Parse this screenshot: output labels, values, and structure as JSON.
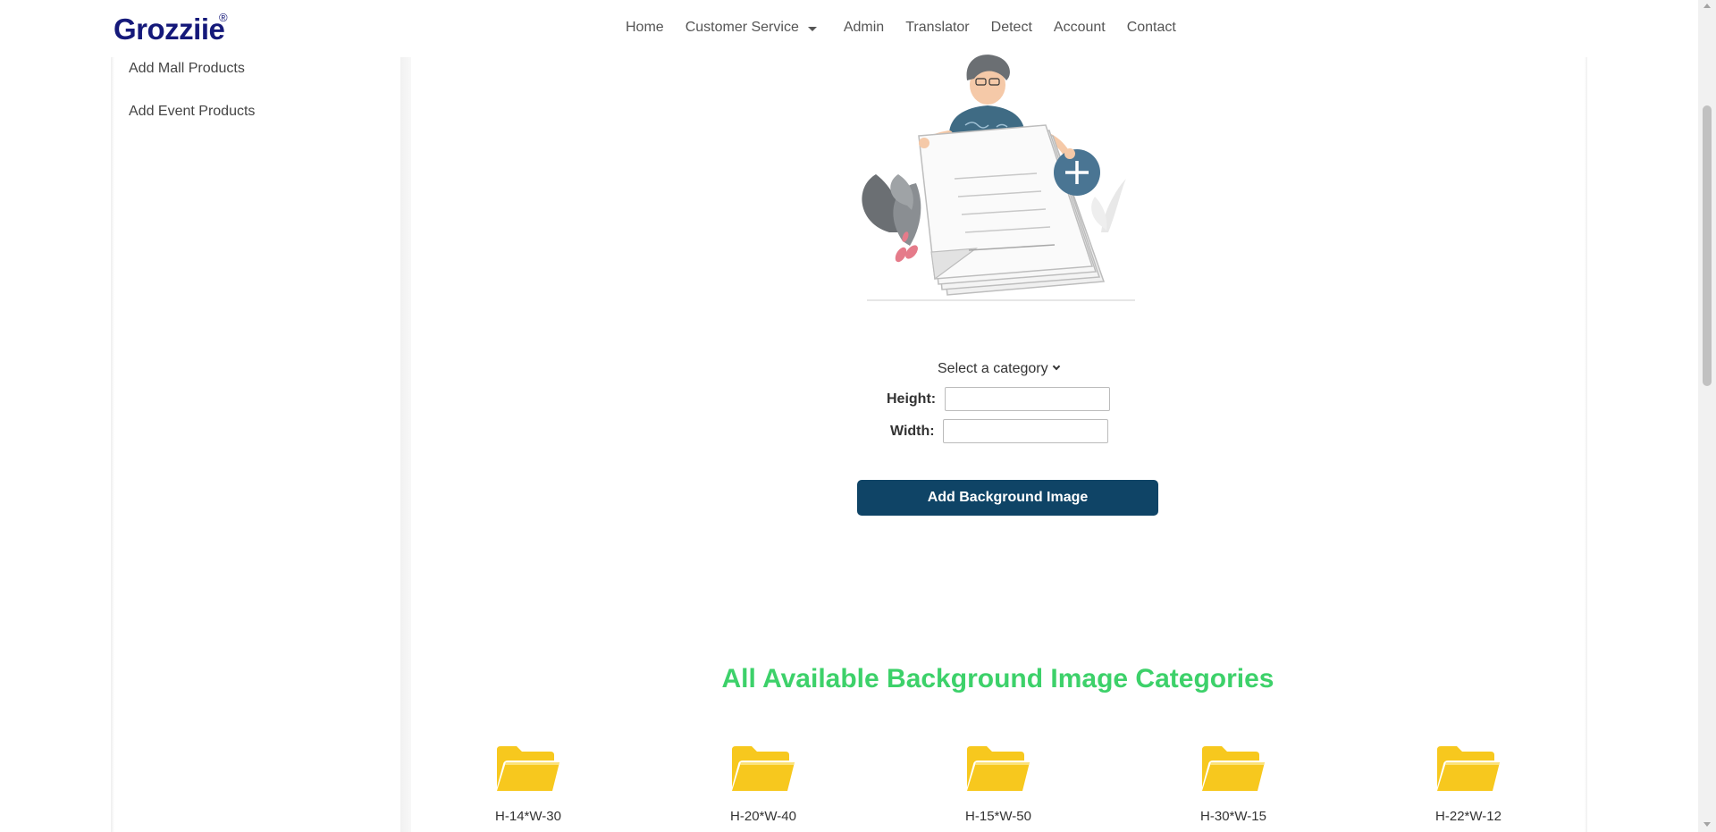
{
  "header": {
    "brand": "Grozziie",
    "brand_mark": "®",
    "nav": [
      {
        "label": "Home"
      },
      {
        "label": "Customer Service"
      },
      {
        "label": "Admin"
      },
      {
        "label": "Translator"
      },
      {
        "label": "Detect"
      },
      {
        "label": "Account"
      },
      {
        "label": "Contact"
      }
    ]
  },
  "sidebar": {
    "items": [
      {
        "label": "Add Mall Products"
      },
      {
        "label": "Add Event Products"
      }
    ]
  },
  "form": {
    "category_select": "Select a category",
    "height_label": "Height:",
    "width_label": "Width:",
    "height_value": "",
    "width_value": "",
    "submit_label": "Add Background Image"
  },
  "categories_section": {
    "title": "All Available Background Image Categories",
    "folders": [
      {
        "label": "H-14*W-30",
        "icon": "folder-open-icon"
      },
      {
        "label": "H-20*W-40",
        "icon": "folder-open-icon"
      },
      {
        "label": "H-15*W-50",
        "icon": "folder-open-icon"
      },
      {
        "label": "H-30*W-15",
        "icon": "folder-open-icon"
      },
      {
        "label": "H-22*W-12",
        "icon": "folder-open-icon"
      }
    ]
  },
  "colors": {
    "brand": "#15197a",
    "button": "#0f4466",
    "title": "#3dd16a",
    "folder": "#f7c81e",
    "accent_circle": "#4a7593"
  }
}
